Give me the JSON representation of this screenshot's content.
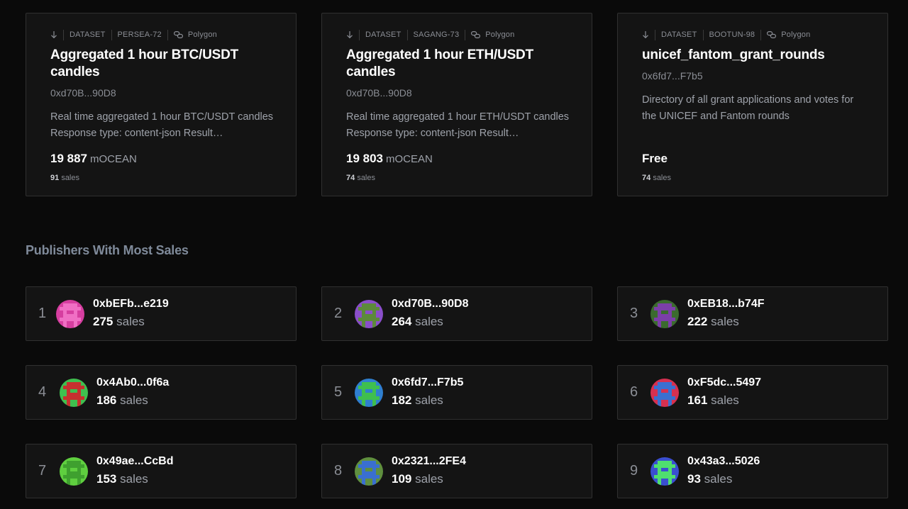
{
  "assets": [
    {
      "type": "DATASET",
      "symbol": "PERSEA-72",
      "network": "Polygon",
      "title": "Aggregated 1 hour BTC/USDT candles",
      "owner": "0xd70B...90D8",
      "description": "Real time aggregated 1 hour BTC/USDT candles Response type: content-json Result…",
      "price": "19 887",
      "price_unit": "mOCEAN",
      "sales_count": "91",
      "sales_label": "sales"
    },
    {
      "type": "DATASET",
      "symbol": "SAGANG-73",
      "network": "Polygon",
      "title": "Aggregated 1 hour ETH/USDT candles",
      "owner": "0xd70B...90D8",
      "description": "Real time aggregated 1 hour ETH/USDT candles Response type: content-json Result…",
      "price": "19 803",
      "price_unit": "mOCEAN",
      "sales_count": "74",
      "sales_label": "sales"
    },
    {
      "type": "DATASET",
      "symbol": "BOOTUN-98",
      "network": "Polygon",
      "title": "unicef_fantom_grant_rounds",
      "owner": "0x6fd7...F7b5",
      "description": "Directory of all grant applications and votes for the UNICEF and Fantom rounds",
      "price": "Free",
      "price_unit": "",
      "sales_count": "74",
      "sales_label": "sales"
    }
  ],
  "publishers_section": {
    "title": "Publishers With Most Sales",
    "sales_label": "sales",
    "items": [
      {
        "rank": "1",
        "address": "0xbEFb...e219",
        "sales": "275",
        "avatar_bg": "#d63ea0",
        "avatar_fg": "#f06fc4"
      },
      {
        "rank": "2",
        "address": "0xd70B...90D8",
        "sales": "264",
        "avatar_bg": "#8a4fc9",
        "avatar_fg": "#5c8a3a"
      },
      {
        "rank": "3",
        "address": "0xEB18...b74F",
        "sales": "222",
        "avatar_bg": "#3b6b2e",
        "avatar_fg": "#7b3fa8"
      },
      {
        "rank": "4",
        "address": "0x4Ab0...0f6a",
        "sales": "186",
        "avatar_bg": "#3fbf4f",
        "avatar_fg": "#c7302f"
      },
      {
        "rank": "5",
        "address": "0x6fd7...F7b5",
        "sales": "182",
        "avatar_bg": "#2f7fcf",
        "avatar_fg": "#3fbf4f"
      },
      {
        "rank": "6",
        "address": "0xF5dc...5497",
        "sales": "161",
        "avatar_bg": "#d63050",
        "avatar_fg": "#3a6fd0"
      },
      {
        "rank": "7",
        "address": "0x49ae...CcBd",
        "sales": "153",
        "avatar_bg": "#5fcf3f",
        "avatar_fg": "#3fa02f"
      },
      {
        "rank": "8",
        "address": "0x2321...2FE4",
        "sales": "109",
        "avatar_bg": "#5f8f3f",
        "avatar_fg": "#3a6fd0"
      },
      {
        "rank": "9",
        "address": "0x43a3...5026",
        "sales": "93",
        "avatar_bg": "#3a4fd0",
        "avatar_fg": "#4fdf6f"
      }
    ]
  }
}
